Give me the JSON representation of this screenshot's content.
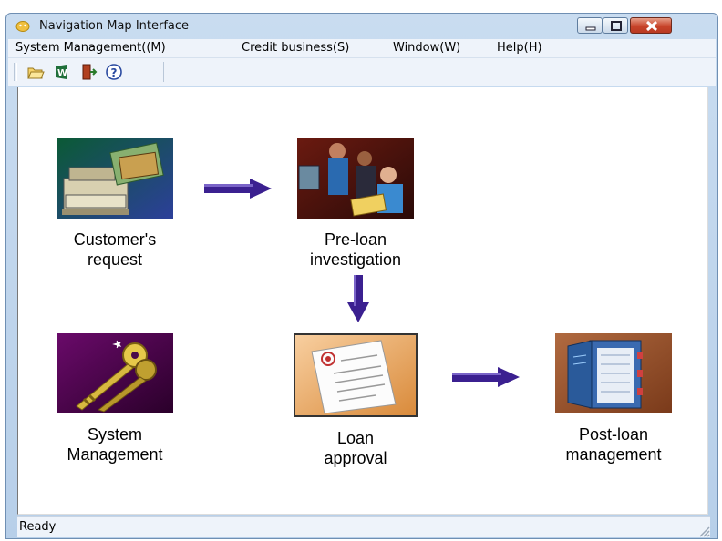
{
  "window": {
    "title": "Navigation Map Interface",
    "controls": [
      "minimize",
      "maximize",
      "close"
    ]
  },
  "menu": {
    "items": [
      {
        "label": "System Management((M)"
      },
      {
        "label": "Credit business(S)"
      },
      {
        "label": "Window(W)"
      },
      {
        "label": "Help(H)"
      }
    ]
  },
  "toolbar": {
    "buttons": [
      {
        "icon": "open-folder-icon"
      },
      {
        "icon": "winword-icon"
      },
      {
        "icon": "exit-door-icon"
      },
      {
        "icon": "help-icon"
      }
    ]
  },
  "nav_map": {
    "nodes": [
      {
        "label": "Customer's\nrequest",
        "icon": "cash-register-icon"
      },
      {
        "label": "Pre-loan\ninvestigation",
        "icon": "business-meeting-icon"
      },
      {
        "label": "System\nManagement",
        "icon": "keys-icon"
      },
      {
        "label": "Loan\napproval",
        "icon": "document-seal-icon"
      },
      {
        "label": "Post-loan\nmanagement",
        "icon": "binder-icon"
      }
    ],
    "arrows": [
      "right",
      "down",
      "right"
    ]
  },
  "status": {
    "text": "Ready"
  },
  "colors": {
    "arrow": "#3b2090",
    "title_bar": "#c9dcf0",
    "menubar": "#eef3fa"
  }
}
